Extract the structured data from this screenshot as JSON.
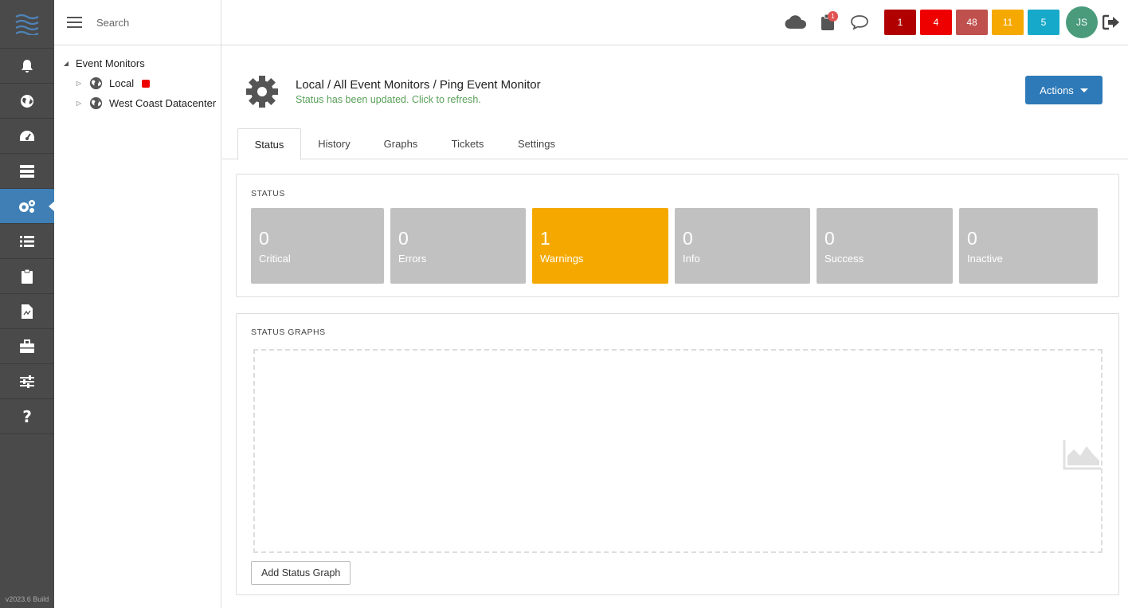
{
  "sidebar": {
    "icons": [
      "bell-icon",
      "globe-icon",
      "dashboard-icon",
      "server-icon",
      "gears-icon",
      "list-icon",
      "clipboard-icon",
      "report-icon",
      "toolbox-icon",
      "sliders-icon",
      "help-icon"
    ],
    "active_index": 4,
    "version": "v2023.6 Build"
  },
  "tree": {
    "search_placeholder": "Search",
    "root": "Event Monitors",
    "children": [
      "Local",
      "West Coast Datacenter"
    ]
  },
  "topbar": {
    "notification_count": "1",
    "counts": [
      {
        "value": "1",
        "color": "#b00000"
      },
      {
        "value": "4",
        "color": "#ee0000"
      },
      {
        "value": "48",
        "color": "#c0504d"
      },
      {
        "value": "11",
        "color": "#f5a900"
      },
      {
        "value": "5",
        "color": "#17a9c9"
      }
    ],
    "avatar": "JS"
  },
  "header": {
    "breadcrumb": "Local / All Event Monitors / Ping Event Monitor",
    "status_message": "Status has been updated. Click to refresh.",
    "actions_label": "Actions"
  },
  "tabs": [
    "Status",
    "History",
    "Graphs",
    "Tickets",
    "Settings"
  ],
  "status_panel": {
    "title": "STATUS",
    "tiles": [
      {
        "value": "0",
        "label": "Critical"
      },
      {
        "value": "0",
        "label": "Errors"
      },
      {
        "value": "1",
        "label": "Warnings",
        "color": "#f5a900"
      },
      {
        "value": "0",
        "label": "Info"
      },
      {
        "value": "0",
        "label": "Success"
      },
      {
        "value": "0",
        "label": "Inactive"
      }
    ]
  },
  "graphs_panel": {
    "title": "STATUS GRAPHS",
    "add_button": "Add Status Graph"
  }
}
